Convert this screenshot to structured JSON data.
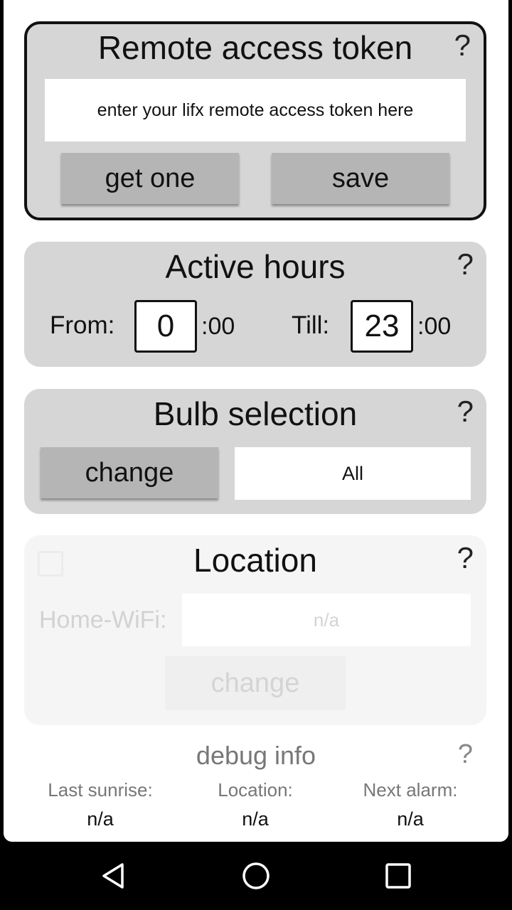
{
  "token_card": {
    "title": "Remote access token",
    "help": "?",
    "input_placeholder": "enter your lifx remote access token here",
    "get_one_label": "get one",
    "save_label": "save"
  },
  "hours_card": {
    "title": "Active hours",
    "help": "?",
    "from_label": "From:",
    "from_value": "0",
    "from_suffix": ":00",
    "till_label": "Till:",
    "till_value": "23",
    "till_suffix": ":00"
  },
  "bulbs_card": {
    "title": "Bulb selection",
    "help": "?",
    "change_label": "change",
    "selection_value": "All"
  },
  "location_card": {
    "title": "Location",
    "help": "?",
    "wifi_label": "Home-WiFi:",
    "wifi_value": "n/a",
    "change_label": "change",
    "enabled": false
  },
  "debug": {
    "title": "debug info",
    "help": "?",
    "columns": [
      {
        "label": "Last sunrise:",
        "value": "n/a"
      },
      {
        "label": "Location:",
        "value": "n/a"
      },
      {
        "label": "Next alarm:",
        "value": "n/a"
      }
    ]
  },
  "navbar": {
    "icons": [
      "back-icon",
      "home-icon",
      "recents-icon"
    ]
  }
}
